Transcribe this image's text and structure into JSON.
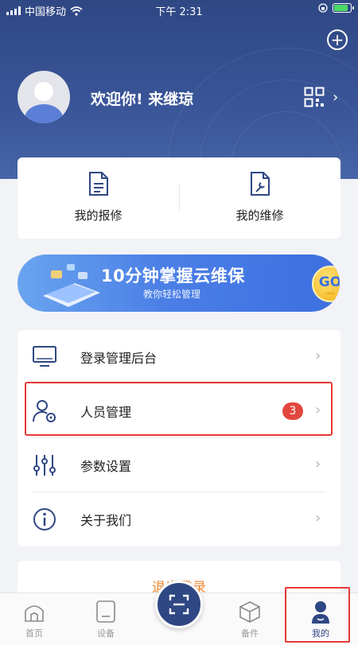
{
  "status_bar": {
    "carrier": "中国移动",
    "time": "下午 2:31"
  },
  "header": {
    "welcome": "欢迎你! 来继琼",
    "add_icon": "plus-circle-icon",
    "qr_icon": "qr-code-icon"
  },
  "quick_actions": [
    {
      "label": "我的报修",
      "icon": "document-list-icon"
    },
    {
      "label": "我的维修",
      "icon": "document-wrench-icon"
    }
  ],
  "banner": {
    "title": "10分钟掌握云维保",
    "subtitle": "教你轻松管理",
    "go_label": "GO"
  },
  "menu": [
    {
      "label": "登录管理后台",
      "icon": "monitor-icon"
    },
    {
      "label": "人员管理",
      "icon": "user-settings-icon",
      "badge": "3"
    },
    {
      "label": "参数设置",
      "icon": "sliders-icon"
    },
    {
      "label": "关于我们",
      "icon": "info-icon"
    }
  ],
  "logout": {
    "label": "退出登录"
  },
  "tabbar": [
    {
      "label": "首页",
      "icon": "home-icon"
    },
    {
      "label": "设备",
      "icon": "device-icon"
    },
    {
      "label": "备件",
      "icon": "box-icon"
    },
    {
      "label": "我的",
      "icon": "user-icon",
      "active": true
    }
  ],
  "colors": {
    "primary": "#2f4783",
    "accent_orange": "#f0862e",
    "badge_red": "#e2463e",
    "highlight_red": "#e53935"
  }
}
